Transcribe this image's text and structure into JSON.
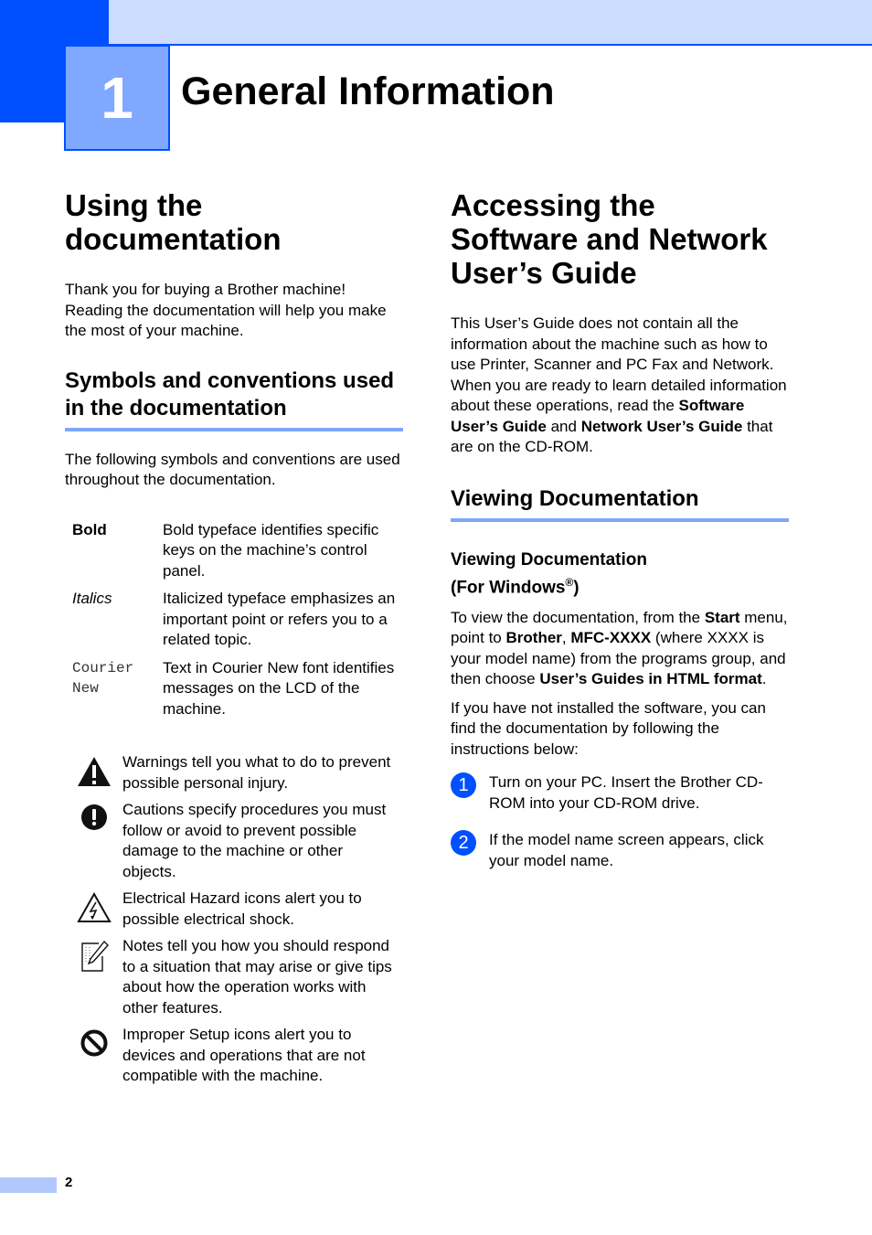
{
  "header": {
    "chapter_number": "1",
    "chapter_title": "General Information"
  },
  "left": {
    "h1": "Using the documentation",
    "intro": "Thank you for buying a Brother machine! Reading the documentation will help you make the most of your machine.",
    "h2": "Symbols and conventions used in the documentation",
    "conv_intro": "The following symbols and conventions are used throughout the documentation.",
    "conventions": [
      {
        "key": "Bold",
        "desc": "Bold typeface identifies specific keys on the machine’s control panel."
      },
      {
        "key": "Italics",
        "desc": "Italicized typeface emphasizes an important point or refers you to a related topic."
      },
      {
        "key": "Courier New",
        "desc": "Text in Courier New font identifies messages on the LCD of the machine."
      }
    ],
    "icons": [
      {
        "icon": "warning-triangle-icon",
        "text": "Warnings tell you what to do to prevent possible personal injury."
      },
      {
        "icon": "caution-exclamation-icon",
        "text": "Cautions specify procedures you must follow or avoid to prevent possible damage to the machine or other objects."
      },
      {
        "icon": "electrical-hazard-icon",
        "text": "Electrical Hazard icons alert you to possible electrical shock."
      },
      {
        "icon": "note-pencil-icon",
        "text": "Notes tell you how you should respond to a situation that may arise or give tips about how the operation works with other features."
      },
      {
        "icon": "prohibited-icon",
        "text": "Improper Setup icons alert you to devices and operations that are not compatible with the machine."
      }
    ]
  },
  "right": {
    "h1": "Accessing the Software and Network User’s Guide",
    "intro_a": "This User’s Guide does not contain all the information about the machine such as how to use Printer, Scanner and PC Fax and Network. When you are ready to learn detailed information about these operations, read the ",
    "intro_b1": "Software User’s Guide",
    "intro_c": " and ",
    "intro_b2": "Network User’s Guide",
    "intro_d": " that are on the CD-ROM.",
    "h2": "Viewing Documentation",
    "h3_line1": "Viewing Documentation",
    "h3_line2": "(For Windows",
    "h3_reg": "®",
    "h3_close": ")",
    "view_a": "To view the documentation, from the ",
    "view_start": "Start",
    "view_b": " menu, point to ",
    "view_brother": "Brother",
    "view_comma": ", ",
    "view_mfc": "MFC-XXXX",
    "view_c": " (where XXXX is your model name) from the programs group, and then choose ",
    "view_html": "User’s Guides in HTML format",
    "view_end": ".",
    "not_installed": "If you have not installed the software, you can find the documentation by following the instructions below:",
    "steps": [
      {
        "num": "1",
        "text": "Turn on your PC. Insert the Brother CD-ROM into your CD-ROM drive."
      },
      {
        "num": "2",
        "text": "If the model name screen appears, click your model name."
      }
    ]
  },
  "footer": {
    "page_number": "2"
  }
}
